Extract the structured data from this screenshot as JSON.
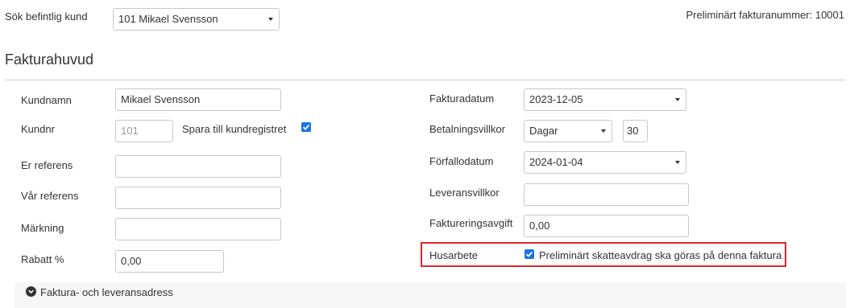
{
  "top": {
    "search_label": "Sök befintlig kund",
    "customer_select_value": "101 Mikael Svensson",
    "invoice_number_label": "Preliminärt fakturanummer: 10001"
  },
  "section": {
    "title": "Fakturahuvud"
  },
  "left": {
    "kundnamn_label": "Kundnamn",
    "kundnamn_value": "Mikael Svensson",
    "kundnr_label": "Kundnr",
    "kundnr_value": "101",
    "save_label": "Spara till kundregistret",
    "save_checked": true,
    "er_referens_label": "Er referens",
    "er_referens_value": "",
    "var_referens_label": "Vår referens",
    "var_referens_value": "",
    "markning_label": "Märkning",
    "markning_value": "",
    "rabatt_label": "Rabatt %",
    "rabatt_value": "0,00"
  },
  "right": {
    "fakturadatum_label": "Fakturadatum",
    "fakturadatum_value": "2023-12-05",
    "betalningsvillkor_label": "Betalningsvillkor",
    "betalningsvillkor_type": "Dagar",
    "betalningsvillkor_days": "30",
    "forfallodatum_label": "Förfallodatum",
    "forfallodatum_value": "2024-01-04",
    "leveransvillkor_label": "Leveransvillkor",
    "leveransvillkor_value": "",
    "faktureringsavgift_label": "Faktureringsavgift",
    "faktureringsavgift_value": "0,00",
    "husarbete_label": "Husarbete",
    "husarbete_checkbox_label": "Preliminärt skatteavdrag ska göras på denna faktura",
    "husarbete_checked": true
  },
  "address_section": {
    "label": "Faktura- och leveransadress"
  },
  "colors": {
    "accent": "#1a73e8",
    "highlight_border": "#d9262c"
  }
}
